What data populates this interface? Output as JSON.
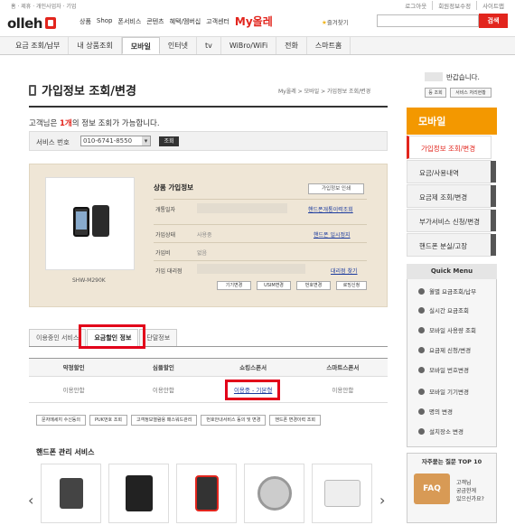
{
  "top_left": "홈 · 제휴 · 개인사업자 · 기업",
  "top_right": [
    "로그아웃",
    "회원정보수정",
    "사이트맵"
  ],
  "logo": "olleh",
  "gnav": [
    "상품",
    "Shop",
    "폰서비스",
    "콘텐츠",
    "혜택/멤버십",
    "고객센터"
  ],
  "gnav_myolle": "My올레",
  "favorite": "즐겨찾기",
  "search_btn": "검색",
  "tabs": [
    "요금 조회/납부",
    "내 상품조회",
    "모바일",
    "인터넷",
    "tv",
    "WiBro/WiFi",
    "전화",
    "스마트홈"
  ],
  "page_title": "가입정보 조회/변경",
  "breadcrumb": "My올레 > 모바일 > 가입정보 조회/변경",
  "notice": {
    "pre": "고객님은 ",
    "count": "1개",
    "post": "의 정보 조회가 가능합니다."
  },
  "service": {
    "label": "서비스 번호",
    "value": "010-6741-8550",
    "btn": "조회"
  },
  "product": {
    "title": "상품 가입정보",
    "print": "가입정보 인쇄",
    "model": "SHW-M290K",
    "rows": [
      {
        "label": "개통일자",
        "value": "",
        "link": "핸드폰개통이력조회"
      },
      {
        "label": "가입상태",
        "value": "사용중",
        "link": "핸드폰 일시정지"
      },
      {
        "label": "가입비",
        "value": "없음",
        "link": ""
      },
      {
        "label": "가입 대리점",
        "value": "",
        "link": "대리점 찾기"
      }
    ],
    "buttons": [
      "기기변경",
      "USIM변경",
      "번호변경",
      "로밍신청"
    ]
  },
  "subtabs": [
    "이용중인 서비스",
    "요금할인 정보",
    "단말정보"
  ],
  "table": {
    "headers": [
      "약정할인",
      "심플할인",
      "쇼킹스폰서",
      "스마트스폰서"
    ],
    "row": [
      "이용안함",
      "이용안함",
      "이용중 - 기본형",
      "이용안함"
    ]
  },
  "bottom_buttons": [
    "문자메세지 수신동의",
    "PUK번호 조회",
    "고객정보열람용 패스워드관리",
    "번호안내서비스 동의 및 변경",
    "핸드폰 변경이력 조회"
  ],
  "handset_title": "핸드폰 관리 서비스",
  "side": {
    "welcome": "반갑습니다.",
    "btn1": "등 조회",
    "btn2": "서비스 처리현황",
    "section": "모바일",
    "menu": [
      "가입정보 조회/변경",
      "요금/사용내역",
      "요금제 조회/변경",
      "부가서비스 신청/변경",
      "핸드폰 분실/고장"
    ],
    "quick_title": "Quick Menu",
    "quick": [
      "월별 요금조회/납부",
      "실시간 요금조회",
      "모바일 사용량 조회",
      "요금제 신청/변경",
      "모바일 번호변경",
      "모바일 기기변경",
      "명의 변경",
      "설치장소 변경"
    ],
    "faq_title": "자주묻는 질문 TOP 10",
    "faq_img": "FAQ",
    "faq_text": [
      "고객님",
      "궁금한게",
      "있으신가요?"
    ]
  },
  "accent": "#e2251d",
  "orange": "#f39800"
}
